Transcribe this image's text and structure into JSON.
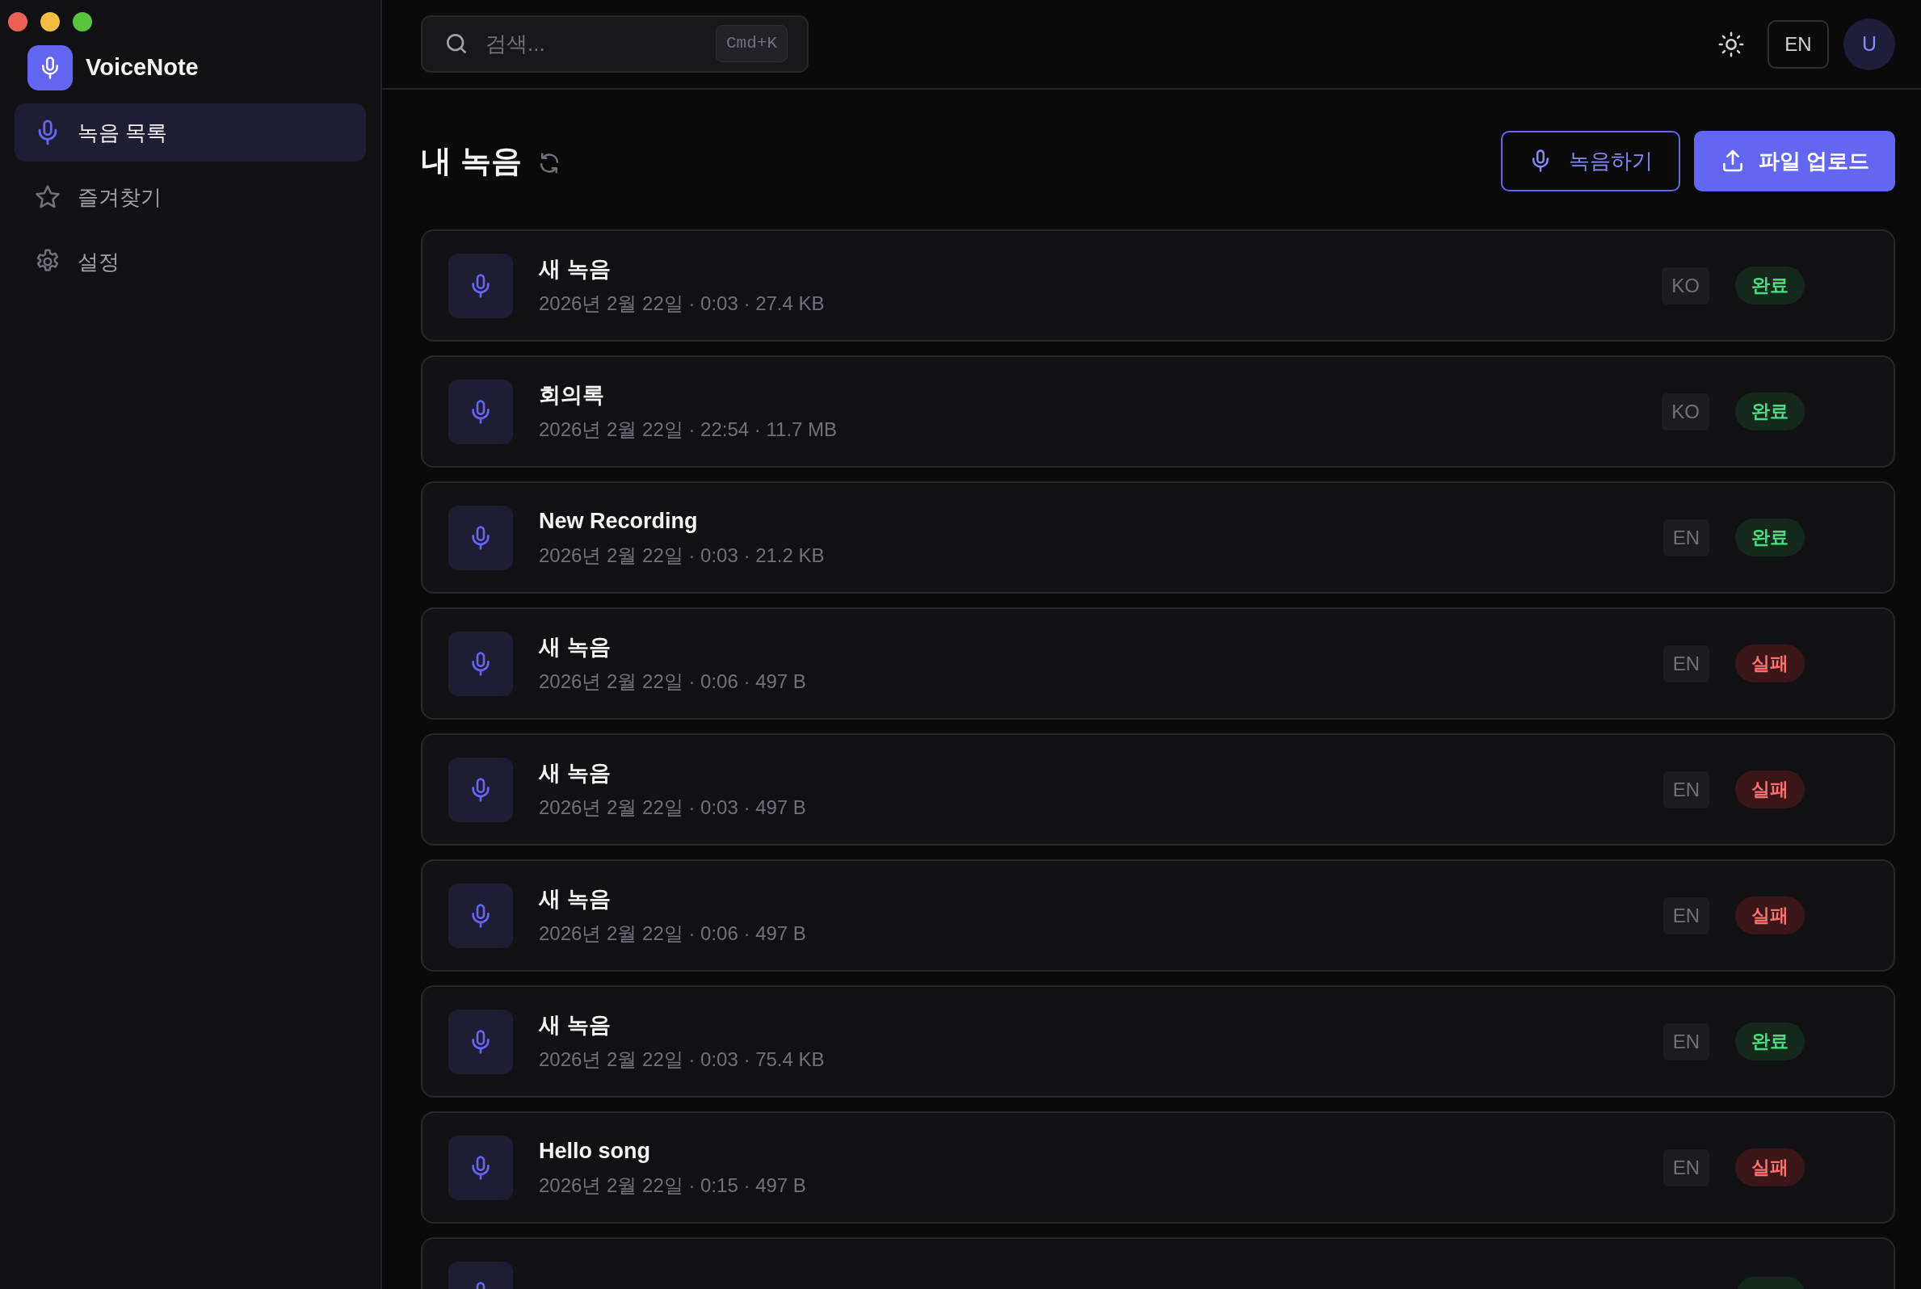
{
  "sidebar": {
    "brand": "VoiceNote",
    "items": [
      {
        "label": "녹음 목록",
        "selected": true
      },
      {
        "label": "즐겨찾기",
        "selected": false
      },
      {
        "label": "설정",
        "selected": false
      }
    ]
  },
  "topbar": {
    "search": {
      "placeholder": "검색...",
      "shortcut": "Cmd+K"
    },
    "language": "EN",
    "avatar": "U"
  },
  "header": {
    "title": "내 녹음",
    "buttons": [
      {
        "label": "녹음하기",
        "kind": "outline"
      },
      {
        "label": "파일 업로드",
        "kind": "primary"
      }
    ]
  },
  "recordings": [
    {
      "title": "새 녹음",
      "meta": "2026년 2월 22일 · 0:03 · 27.4 KB",
      "language": "KO",
      "status": "완료",
      "kind": "done"
    },
    {
      "title": "회의록",
      "meta": "2026년 2월 22일 · 22:54 · 11.7 MB",
      "language": "KO",
      "status": "완료",
      "kind": "done"
    },
    {
      "title": "New Recording",
      "meta": "2026년 2월 22일 · 0:03 · 21.2 KB",
      "language": "EN",
      "status": "완료",
      "kind": "done"
    },
    {
      "title": "새 녹음",
      "meta": "2026년 2월 22일 · 0:06 · 497 B",
      "language": "EN",
      "status": "실패",
      "kind": "failed"
    },
    {
      "title": "새 녹음",
      "meta": "2026년 2월 22일 · 0:03 · 497 B",
      "language": "EN",
      "status": "실패",
      "kind": "failed"
    },
    {
      "title": "새 녹음",
      "meta": "2026년 2월 22일 · 0:06 · 497 B",
      "language": "EN",
      "status": "실패",
      "kind": "failed"
    },
    {
      "title": "새 녹음",
      "meta": "2026년 2월 22일 · 0:03 · 75.4 KB",
      "language": "EN",
      "status": "완료",
      "kind": "done"
    },
    {
      "title": "Hello song",
      "meta": "2026년 2월 22일 · 0:15 · 497 B",
      "language": "EN",
      "status": "실패",
      "kind": "failed"
    },
    {
      "kind": "done"
    }
  ]
}
